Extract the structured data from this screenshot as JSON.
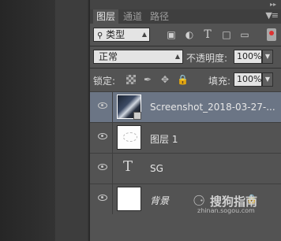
{
  "tabs": [
    {
      "label": "图层",
      "active": true
    },
    {
      "label": "通道",
      "active": false
    },
    {
      "label": "路径",
      "active": false
    }
  ],
  "filter": {
    "kind_label": "类型",
    "search_icon": "search-icon"
  },
  "filter_icons": [
    "image-filter-icon",
    "adjustment-filter-icon",
    "type-filter-icon",
    "shape-filter-icon",
    "smart-object-filter-icon"
  ],
  "blend": {
    "mode": "正常",
    "opacity_label": "不透明度:",
    "opacity_value": "100%"
  },
  "lock": {
    "label": "锁定:",
    "fill_label": "填充:",
    "fill_value": "100%"
  },
  "layers": [
    {
      "name": "Screenshot_2018-03-27-...",
      "selected": true,
      "thumb": "photo"
    },
    {
      "name": "图层 1",
      "selected": false,
      "thumb": "sketch"
    },
    {
      "name": "SG",
      "selected": false,
      "thumb": "type"
    },
    {
      "name": "背景",
      "selected": false,
      "thumb": "white",
      "locked": true
    }
  ],
  "watermark": {
    "name": "搜狗指南",
    "url": "zhinan.sogou.com"
  },
  "colors": {
    "panel": "#535353",
    "selected_layer": "#6b7585"
  }
}
